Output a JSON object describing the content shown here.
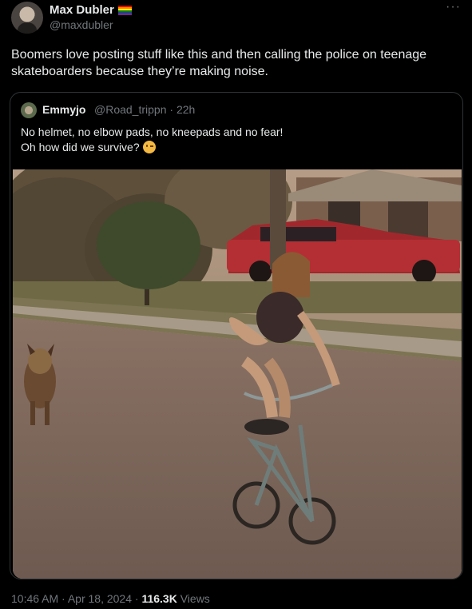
{
  "tweet": {
    "author_name": "Max Dubler",
    "author_handle": "@maxdubler",
    "text": "Boomers love posting stuff like this and then calling the police on teenage skateboarders because they’re making noise.",
    "more_icon": "more-horizontal-icon",
    "flag_icon": "rainbow-flag-icon"
  },
  "quote": {
    "author_name": "Emmyjo",
    "author_handle": "@Road_trippn",
    "time": "· 22h",
    "text_line1": "No helmet, no elbow pads, no kneepads and no fear!",
    "text_line2": "Oh how did we survive?",
    "emoji_icon": "winking-face-icon"
  },
  "meta": {
    "time": "10:46 AM",
    "date": "· Apr 18, 2024 ·",
    "views_count": "116.3K",
    "views_label": "Views"
  },
  "colors": {
    "background": "#000000",
    "text": "#e7e9ea",
    "secondary": "#71767b",
    "border": "#2f3336"
  }
}
